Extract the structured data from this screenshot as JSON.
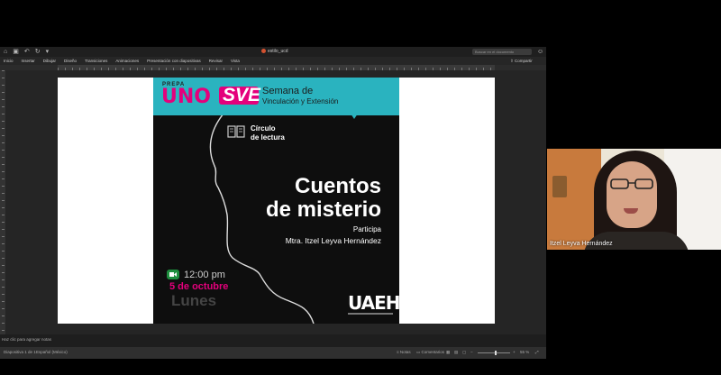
{
  "window": {
    "title": "estilo_ucd",
    "search_placeholder": "Buscar en el documento",
    "share_label": "Compartir"
  },
  "menu": [
    "Inicio",
    "Insertar",
    "Dibujar",
    "Diseño",
    "Transiciones",
    "Animaciones",
    "Presentación con diapositivas",
    "Revisar",
    "Vista"
  ],
  "slide": {
    "header": {
      "prepa": "PREPA",
      "uno": "UNO",
      "sve": "SVE",
      "semana": "Semana de",
      "vinculacion": "Vinculación y Extensión"
    },
    "circulo_line1": "Círculo",
    "circulo_line2": "de lectura",
    "title_line1": "Cuentos",
    "title_line2": "de misterio",
    "participa": "Participa",
    "presenter": "Mtra. Itzel Leyva Hernández",
    "time": "12:00 pm",
    "date": "5 de octubre",
    "day": "Lunes",
    "logo": "UAEH"
  },
  "notes_placeholder": "Haz clic para agregar notas",
  "status": {
    "slide_counter": "Diapositiva 1 de 1",
    "language": "Español (México)",
    "notes_btn": "Notas",
    "comments_btn": "Comentarios",
    "zoom": "55 %"
  },
  "participant": {
    "name": "Itzel Leyva Hernández"
  },
  "colors": {
    "banner": "#2ab3bf",
    "brand_magenta": "#e4007c",
    "poster_bg": "#0e0e0e"
  }
}
